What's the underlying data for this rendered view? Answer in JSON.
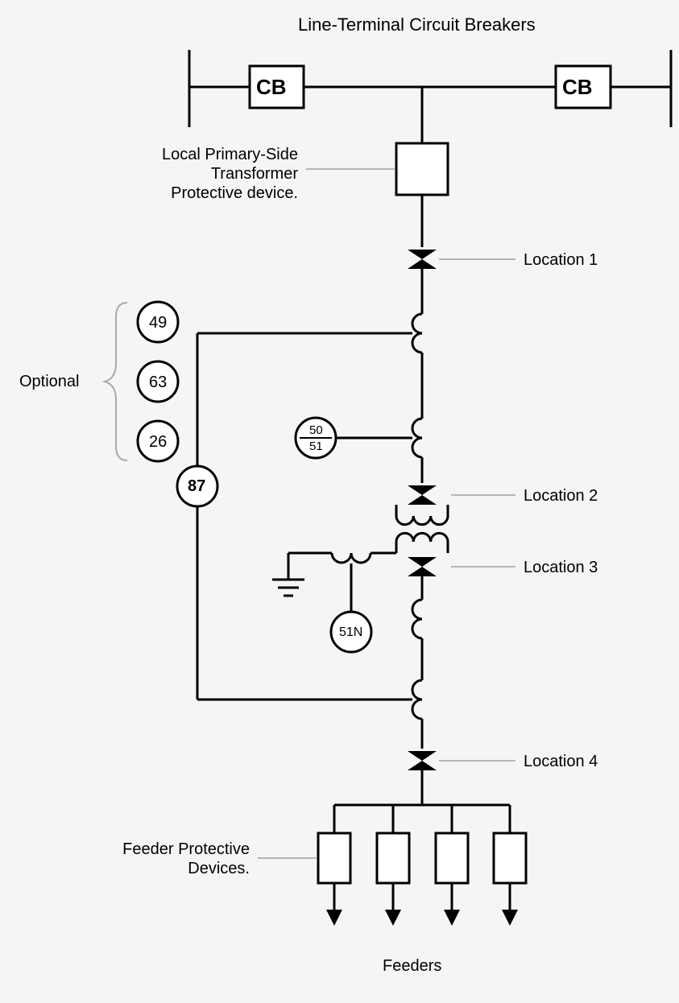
{
  "title": "Line-Terminal Circuit Breakers",
  "cb_label": "CB",
  "primary_device_label": "Local Primary-Side\nTransformer\nProtective device.",
  "optional_label": "Optional",
  "relay_49": "49",
  "relay_63": "63",
  "relay_26": "26",
  "relay_87": "87",
  "relay_50_51_top": "50",
  "relay_50_51_bot": "51",
  "relay_51N": "51N",
  "loc1": "Location 1",
  "loc2": "Location 2",
  "loc3": "Location 3",
  "loc4": "Location 4",
  "feeder_protect_label": "Feeder Protective\nDevices.",
  "feeders_label": "Feeders"
}
